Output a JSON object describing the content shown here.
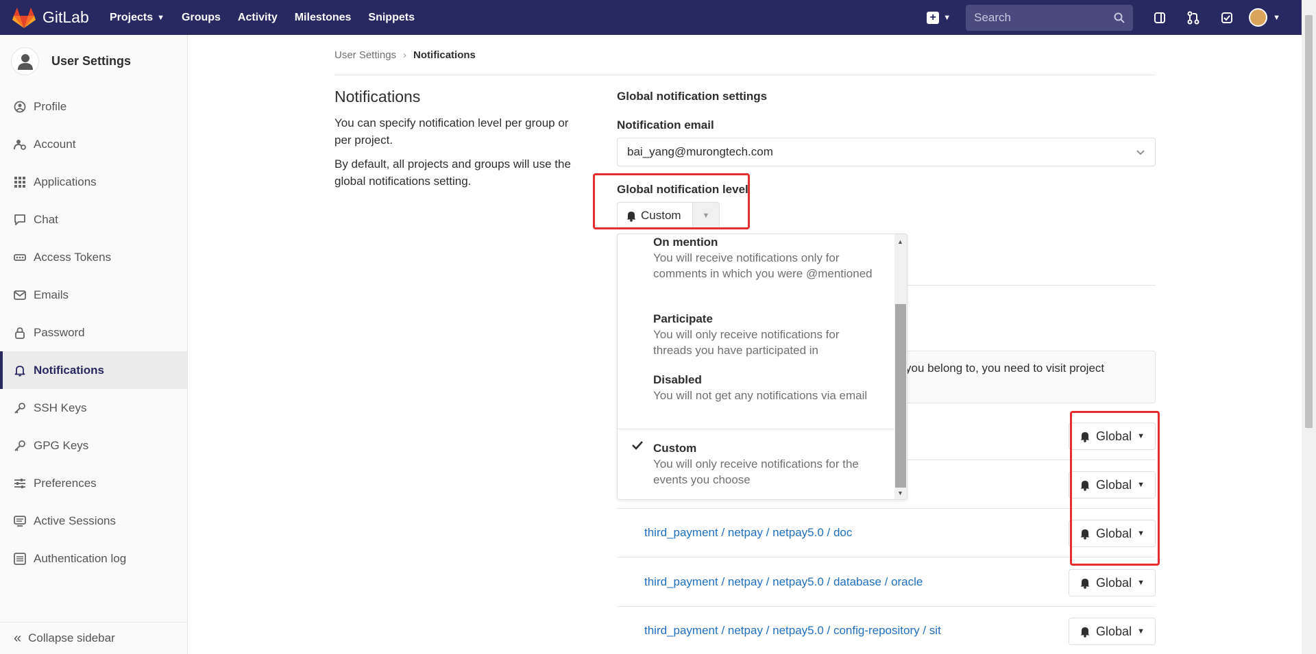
{
  "navbar": {
    "brand": "GitLab",
    "links": [
      "Projects",
      "Groups",
      "Activity",
      "Milestones",
      "Snippets"
    ],
    "search_placeholder": "Search"
  },
  "sidebar": {
    "context_title": "User Settings",
    "items": [
      {
        "label": "Profile",
        "icon": "profile-icon"
      },
      {
        "label": "Account",
        "icon": "account-icon"
      },
      {
        "label": "Applications",
        "icon": "applications-icon"
      },
      {
        "label": "Chat",
        "icon": "chat-icon"
      },
      {
        "label": "Access Tokens",
        "icon": "key-icon"
      },
      {
        "label": "Emails",
        "icon": "mail-icon"
      },
      {
        "label": "Password",
        "icon": "lock-icon"
      },
      {
        "label": "Notifications",
        "icon": "bell-icon",
        "active": true
      },
      {
        "label": "SSH Keys",
        "icon": "key-icon"
      },
      {
        "label": "GPG Keys",
        "icon": "key-icon"
      },
      {
        "label": "Preferences",
        "icon": "sliders-icon"
      },
      {
        "label": "Active Sessions",
        "icon": "monitor-icon"
      },
      {
        "label": "Authentication log",
        "icon": "list-icon"
      }
    ],
    "collapse_label": "Collapse sidebar"
  },
  "breadcrumb": {
    "parent": "User Settings",
    "current": "Notifications"
  },
  "intro": {
    "title": "Notifications",
    "p1": "You can specify notification level per group or per project.",
    "p2": "By default, all projects and groups will use the global notifications setting."
  },
  "settings": {
    "section_title": "Global notification settings",
    "email_label": "Notification email",
    "email_value": "bai_yang@murongtech.com",
    "level_label": "Global notification level",
    "level_value": "Custom"
  },
  "dropdown": {
    "options": [
      {
        "title": "On mention",
        "desc": "You will receive notifications only for comments in which you were @mentioned"
      },
      {
        "title": "Participate",
        "desc": "You will only receive notifications for threads you have participated in"
      },
      {
        "title": "Disabled",
        "desc": "You will not get any notifications via email"
      },
      {
        "title": "Custom",
        "desc": "You will only receive notifications for the events you choose",
        "selected": true
      }
    ]
  },
  "info_text": "you belong to, you need to visit project",
  "projects": [
    {
      "path": "",
      "level": "Global"
    },
    {
      "path": "",
      "level": "Global"
    },
    {
      "path": "third_payment / netpay / netpay5.0 / doc",
      "level": "Global"
    },
    {
      "path": "third_payment / netpay / netpay5.0 / database / oracle",
      "level": "Global"
    },
    {
      "path": "third_payment / netpay / netpay5.0 / config-repository / sit",
      "level": "Global"
    }
  ],
  "colors": {
    "navbar": "#292961",
    "link": "#1f6fbf",
    "highlight": "#e52d2d"
  }
}
